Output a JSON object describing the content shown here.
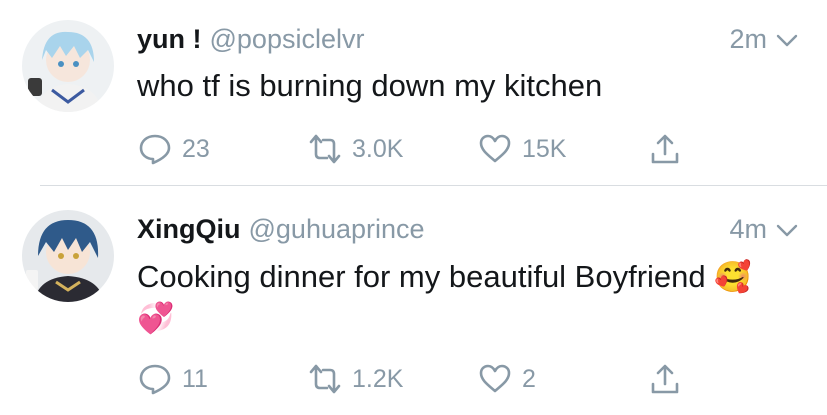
{
  "tweets": [
    {
      "name": "yun !",
      "handle": "@popsiclelvr",
      "time": "2m",
      "text": "who tf is burning down my kitchen",
      "emoji_line1": "",
      "emoji_line2": "",
      "replies": "23",
      "retweets": "3.0K",
      "likes": "15K"
    },
    {
      "name": "XingQiu",
      "handle": "@guhuaprince",
      "time": "4m",
      "text": "Cooking dinner for my beautiful Boyfriend",
      "emoji_line1": "🥰",
      "emoji_line2": "💞",
      "replies": "11",
      "retweets": "1.2K",
      "likes": "2"
    }
  ],
  "colors": {
    "text": "#14171a",
    "muted": "#8899a6",
    "divider": "#d9dde1",
    "avatar1_hair": "#a9d4ec",
    "avatar2_hair": "#2f5a8a"
  },
  "icons": [
    "reply-icon",
    "retweet-icon",
    "like-icon",
    "share-icon",
    "chevron-down-icon"
  ]
}
